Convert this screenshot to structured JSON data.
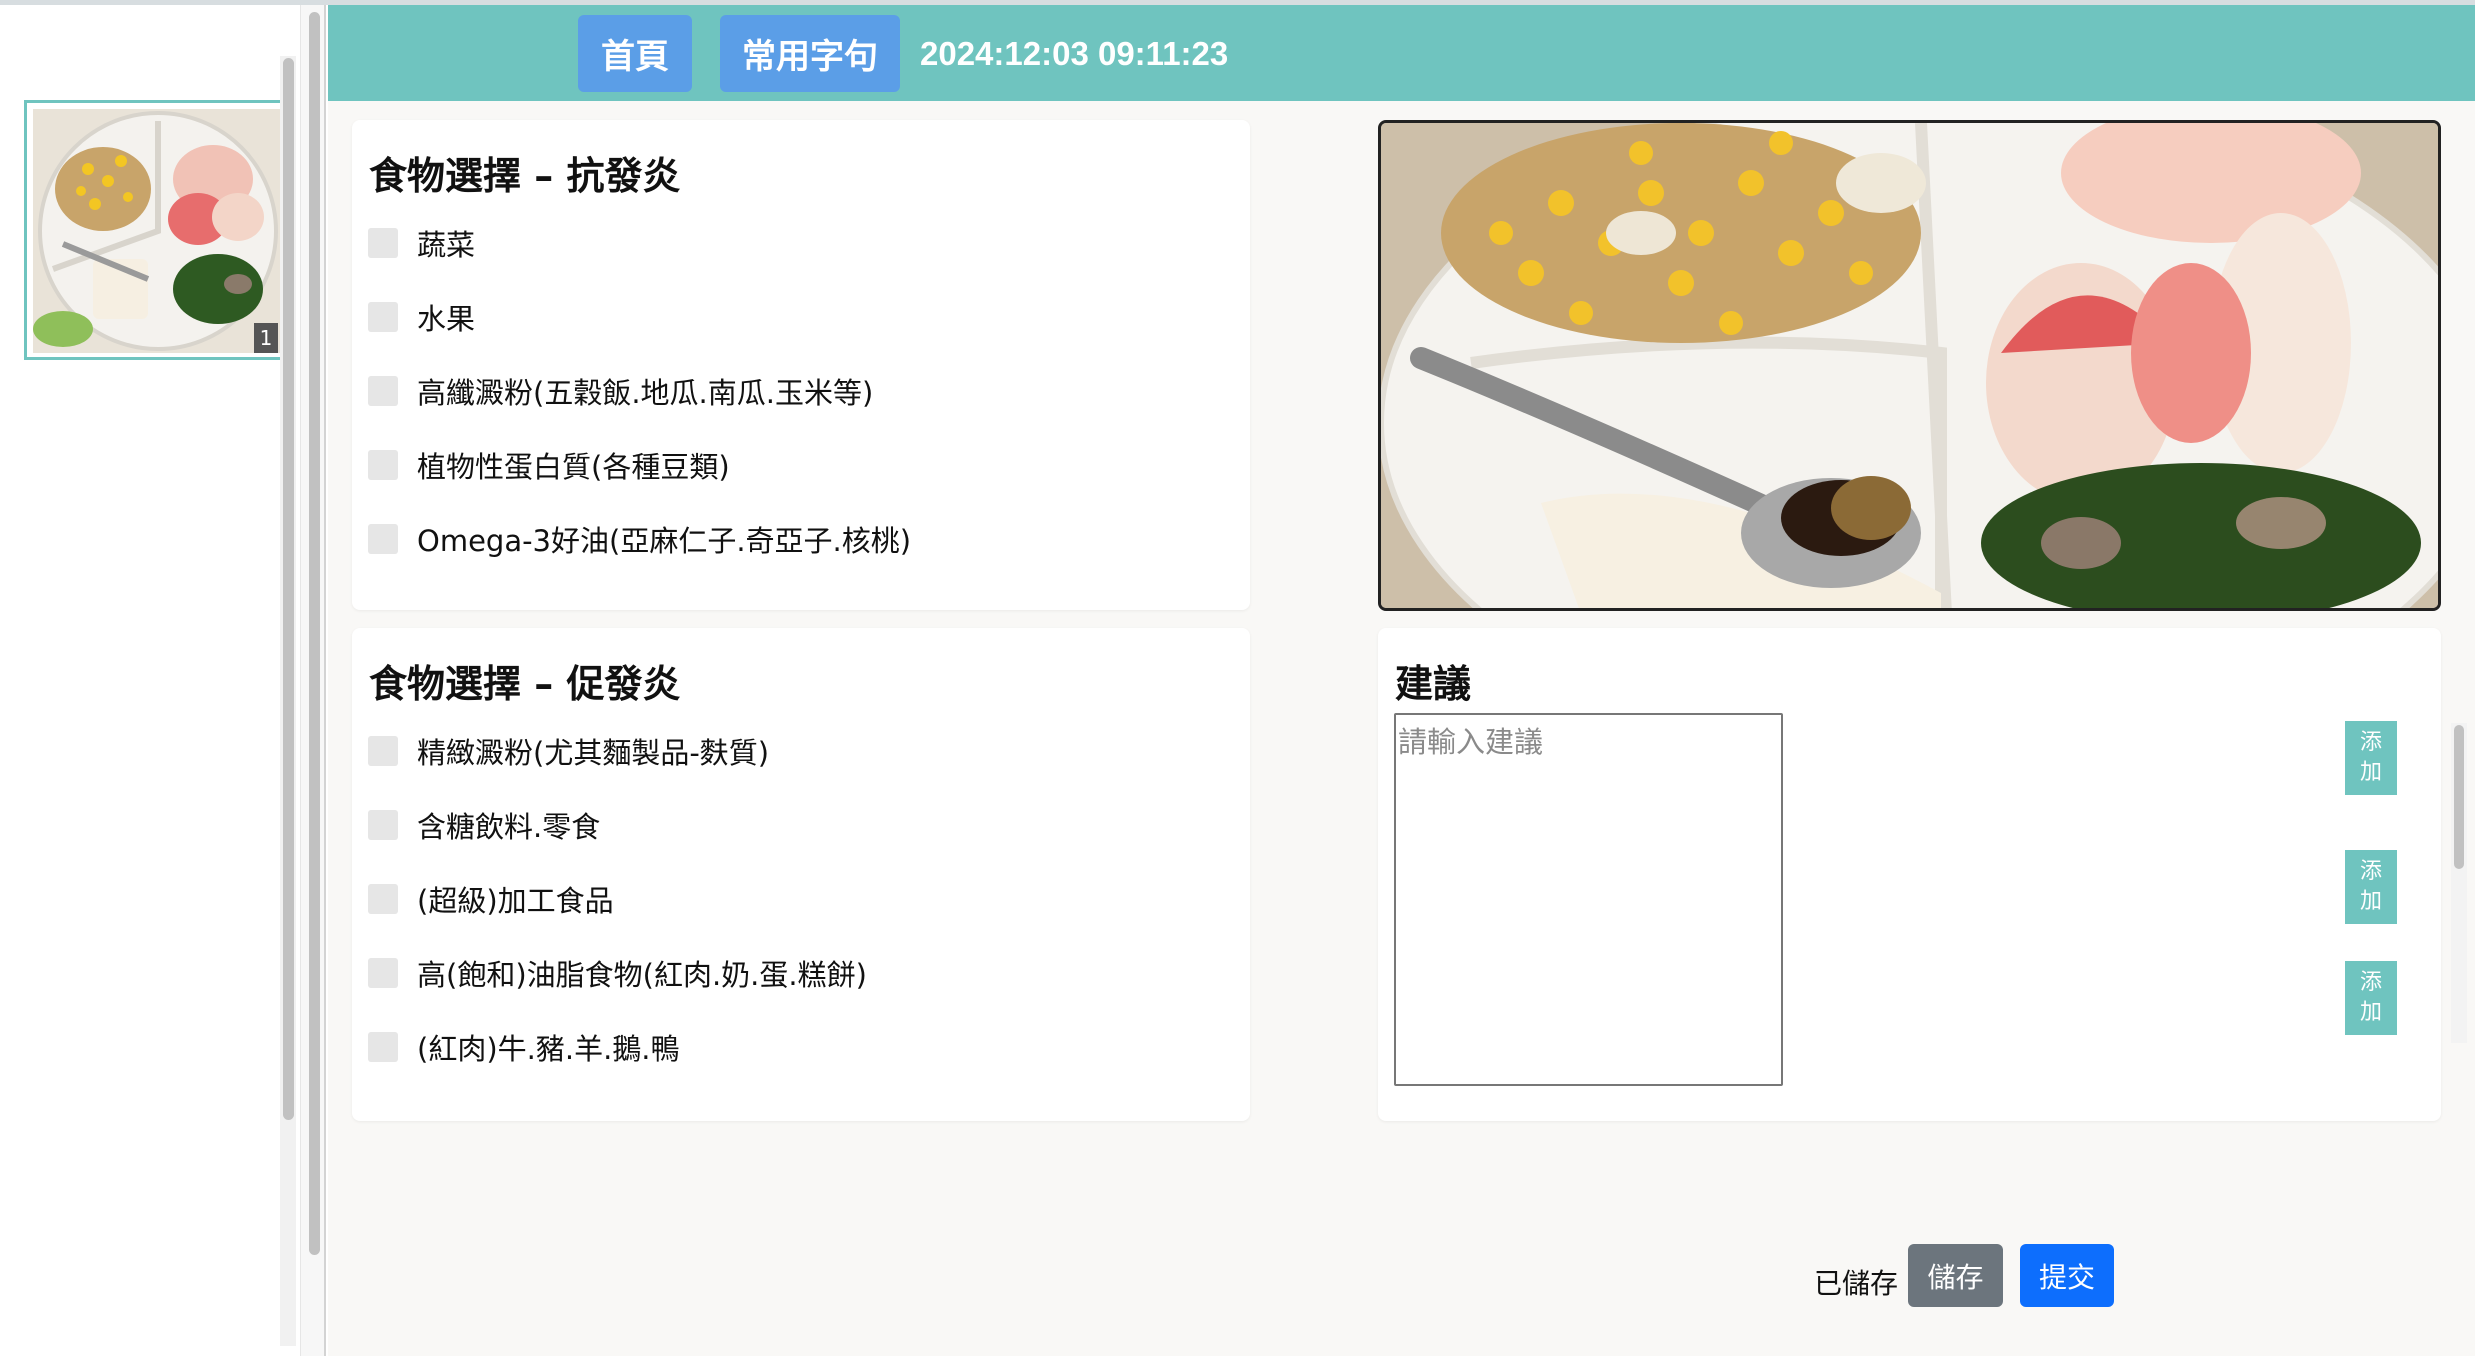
{
  "header": {
    "home_label": "首頁",
    "phrases_label": "常用字句",
    "datetime": "2024:12:03 09:11:23"
  },
  "sidebar": {
    "thumbnails": [
      {
        "badge": "1"
      }
    ]
  },
  "anti_inflammatory": {
    "title": "食物選擇 – 抗發炎",
    "options": [
      "蔬菜",
      "水果",
      "高纖澱粉(五穀飯.地瓜.南瓜.玉米等)",
      "植物性蛋白質(各種豆類)",
      "Omega-3好油(亞麻仁子.奇亞子.核桃)"
    ]
  },
  "pro_inflammatory": {
    "title": "食物選擇 – 促發炎",
    "options": [
      "精緻澱粉(尤其麵製品-麩質)",
      "含糖飲料.零食",
      "(超級)加工食品",
      "高(飽和)油脂食物(紅肉.奶.蛋.糕餅)",
      "(紅肉)牛.豬.羊.鵝.鴨"
    ]
  },
  "advice": {
    "title": "建議",
    "placeholder": "請輸入建議",
    "value": "",
    "add_label": "添加"
  },
  "footer": {
    "status": "已儲存",
    "save_label": "儲存",
    "submit_label": "提交"
  },
  "colors": {
    "header_bg": "#6fc4bf",
    "header_button": "#5b9ee7",
    "add_button": "#6fc4bf",
    "save_button": "#6c757d",
    "submit_button": "#0d6efd"
  }
}
